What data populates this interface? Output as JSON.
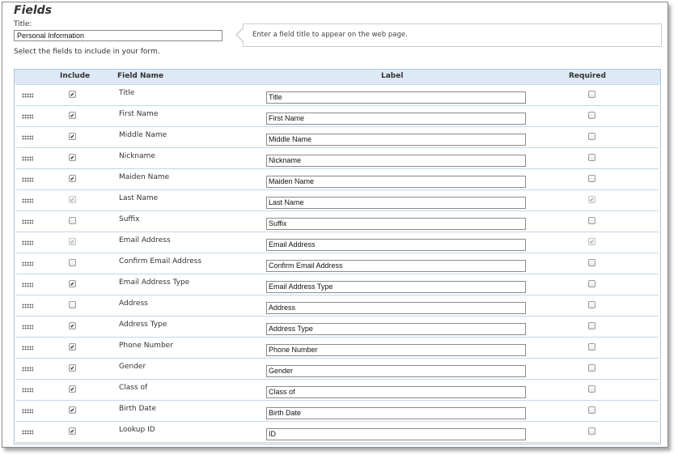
{
  "section": {
    "title": "Fields",
    "title_label": "Title:",
    "title_value": "Personal Information",
    "tip": "Enter a field title to appear on the web page.",
    "instructions": "Select the fields to include in your form."
  },
  "grid": {
    "headers": {
      "include": "Include",
      "field_name": "Field Name",
      "label": "Label",
      "required": "Required"
    },
    "rows": [
      {
        "field_name": "Title",
        "label": "Title",
        "include": true,
        "include_disabled": false,
        "required": false,
        "required_disabled": false
      },
      {
        "field_name": "First Name",
        "label": "First Name",
        "include": true,
        "include_disabled": false,
        "required": false,
        "required_disabled": false
      },
      {
        "field_name": "Middle Name",
        "label": "Middle Name",
        "include": true,
        "include_disabled": false,
        "required": false,
        "required_disabled": false
      },
      {
        "field_name": "Nickname",
        "label": "Nickname",
        "include": true,
        "include_disabled": false,
        "required": false,
        "required_disabled": false
      },
      {
        "field_name": "Maiden Name",
        "label": "Maiden Name",
        "include": true,
        "include_disabled": false,
        "required": false,
        "required_disabled": false
      },
      {
        "field_name": "Last Name",
        "label": "Last Name",
        "include": true,
        "include_disabled": true,
        "required": true,
        "required_disabled": true
      },
      {
        "field_name": "Suffix",
        "label": "Suffix",
        "include": false,
        "include_disabled": false,
        "required": false,
        "required_disabled": false
      },
      {
        "field_name": "Email Address",
        "label": "Email Address",
        "include": true,
        "include_disabled": true,
        "required": true,
        "required_disabled": true
      },
      {
        "field_name": "Confirm Email Address",
        "label": "Confirm Email Address",
        "include": false,
        "include_disabled": false,
        "required": false,
        "required_disabled": false
      },
      {
        "field_name": "Email Address Type",
        "label": "Email Address Type",
        "include": true,
        "include_disabled": false,
        "required": false,
        "required_disabled": false
      },
      {
        "field_name": "Address",
        "label": "Address",
        "include": false,
        "include_disabled": false,
        "required": false,
        "required_disabled": false
      },
      {
        "field_name": "Address Type",
        "label": "Address Type",
        "include": true,
        "include_disabled": false,
        "required": false,
        "required_disabled": false
      },
      {
        "field_name": "Phone Number",
        "label": "Phone Number",
        "include": true,
        "include_disabled": false,
        "required": false,
        "required_disabled": false
      },
      {
        "field_name": "Gender",
        "label": "Gender",
        "include": true,
        "include_disabled": false,
        "required": false,
        "required_disabled": false
      },
      {
        "field_name": "Class of",
        "label": "Class of",
        "include": true,
        "include_disabled": false,
        "required": false,
        "required_disabled": false
      },
      {
        "field_name": "Birth Date",
        "label": "Birth Date",
        "include": true,
        "include_disabled": false,
        "required": false,
        "required_disabled": false
      },
      {
        "field_name": "Lookup ID",
        "label": "ID",
        "include": true,
        "include_disabled": false,
        "required": false,
        "required_disabled": false
      }
    ]
  },
  "icons": {
    "row_handle": "drag-handle-icon"
  },
  "colors": {
    "header_bg": "#dde9f5",
    "row_border": "#c5d5e6"
  }
}
